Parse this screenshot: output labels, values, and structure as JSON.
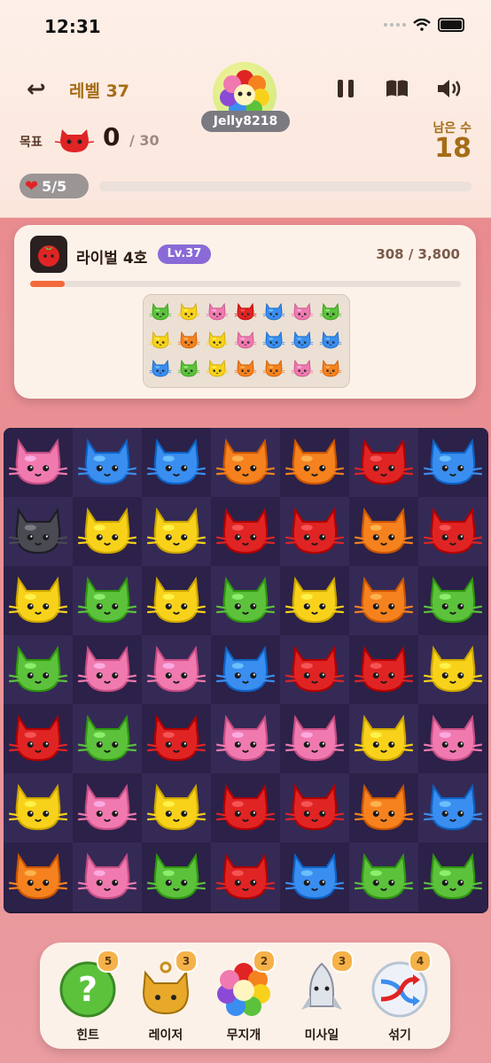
{
  "status": {
    "time": "12:31"
  },
  "header": {
    "level_label": "레벨 37",
    "username": "Jelly8218",
    "goal_label": "목표",
    "goal_count": "0",
    "goal_total": "/ 30",
    "moves_label": "남은 수",
    "moves_count": "18",
    "lives": "5/5"
  },
  "rival": {
    "name": "라이벌 4호",
    "level": "Lv.37",
    "score": "308 / 3,800",
    "progress": 0.08,
    "mini_board": [
      [
        "green",
        "yellow",
        "pink",
        "red",
        "blue",
        "pink",
        "green"
      ],
      [
        "yellow",
        "orange",
        "yellow",
        "pink",
        "blue",
        "blue",
        "blue"
      ],
      [
        "blue",
        "green",
        "yellow",
        "orange",
        "orange",
        "pink",
        "orange"
      ]
    ]
  },
  "board": [
    [
      "pink",
      "blue",
      "blue",
      "orange",
      "orange",
      "red",
      "blue"
    ],
    [
      "black",
      "yellow",
      "yellow",
      "red",
      "red",
      "orange",
      "red"
    ],
    [
      "yellow",
      "green",
      "yellow",
      "green",
      "yellow",
      "orange",
      "green"
    ],
    [
      "green",
      "pink",
      "pink",
      "blue",
      "red",
      "red",
      "yellow"
    ],
    [
      "red",
      "green",
      "red",
      "pink",
      "pink",
      "yellow",
      "pink"
    ],
    [
      "yellow",
      "pink",
      "yellow",
      "red",
      "red",
      "orange",
      "blue"
    ],
    [
      "orange",
      "pink",
      "green",
      "red",
      "blue",
      "green",
      "green"
    ]
  ],
  "colors": {
    "pink": "#f07ab0",
    "blue": "#3a8ef0",
    "orange": "#f5821e",
    "red": "#e02424",
    "yellow": "#f8d21a",
    "green": "#5cc23c",
    "black": "#4a4a52"
  },
  "powerups": [
    {
      "label": "힌트",
      "count": "5",
      "icon": "hint-icon"
    },
    {
      "label": "레이저",
      "count": "3",
      "icon": "laser-cat-icon"
    },
    {
      "label": "무지개",
      "count": "2",
      "icon": "rainbow-icon"
    },
    {
      "label": "미사일",
      "count": "3",
      "icon": "missile-icon"
    },
    {
      "label": "섞기",
      "count": "4",
      "icon": "shuffle-icon"
    }
  ]
}
